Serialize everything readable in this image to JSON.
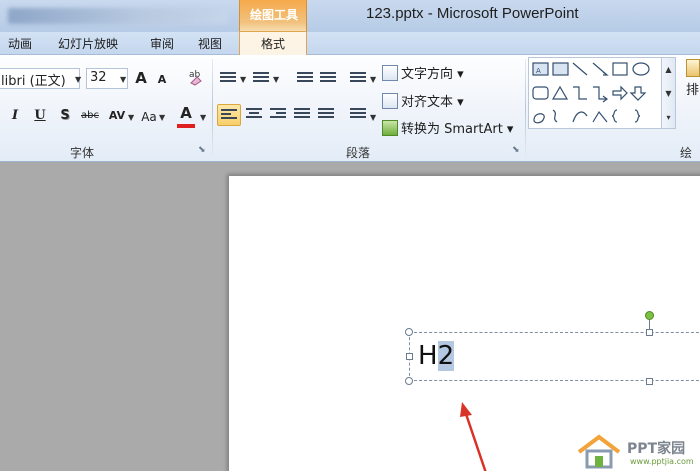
{
  "window": {
    "context_tab_header": "绘图工具",
    "title": "123.pptx - Microsoft PowerPoint"
  },
  "tabs": [
    {
      "label": "动画"
    },
    {
      "label": "幻灯片放映"
    },
    {
      "label": "审阅"
    },
    {
      "label": "视图"
    }
  ],
  "active_tab": "格式",
  "ribbon": {
    "font_group": {
      "label": "字体",
      "font_name": "libri (正文)",
      "font_size": "32",
      "grow_font": "A",
      "shrink_font": "A",
      "italic": "I",
      "underline": "U",
      "shadow": "S",
      "strikethrough": "abc",
      "char_spacing": "AV",
      "change_case": "Aa",
      "font_color": "A",
      "font_color_value": "#e02020"
    },
    "paragraph_group": {
      "label": "段落",
      "text_direction": "文字方向",
      "align_text": "对齐文本",
      "convert_smartart": "转换为 SmartArt"
    },
    "drawing_group": {
      "label": "绘图",
      "arrange_label": "排"
    }
  },
  "slide": {
    "textbox_text_plain": "H",
    "textbox_text_selected": "2"
  },
  "watermark": {
    "name": "PPT家园",
    "url": "www.pptjia.com"
  }
}
